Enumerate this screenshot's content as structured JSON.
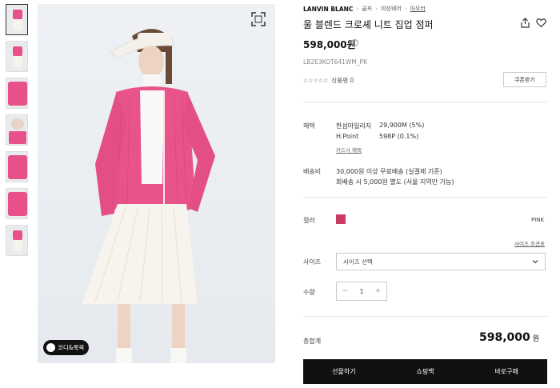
{
  "breadcrumb": {
    "brand": "LANVIN BLANC",
    "items": [
      "골프",
      "여성웨어",
      "아우터"
    ]
  },
  "product": {
    "title": "울 블렌드 크로셰 니트 집업 점퍼",
    "price": "598,000원",
    "price_info_icon": "info-icon",
    "code": "LB2E3KOT641WM_PK",
    "review_label": "상품평 0",
    "stars": "☆☆☆☆☆",
    "coupon_label": "쿠폰받기"
  },
  "image": {
    "coord_button_label": "코디&룩북"
  },
  "benefit": {
    "label": "혜택",
    "rows": [
      {
        "name": "한섬마일리지",
        "value": "29,900M (5%)"
      },
      {
        "name": "H.Point",
        "value": "598P (0.1%)"
      }
    ],
    "card_link": "카드사 혜택"
  },
  "shipping": {
    "label": "배송비",
    "line1": "30,000원 이상 무료배송 (실결제 기준)",
    "line2": "회배송 시 5,000원 별도 (서울 지역만 가능)"
  },
  "color": {
    "label": "컬러",
    "swatch": "#c93d63",
    "name": "PINK"
  },
  "size": {
    "guide_link": "사이즈 조견표",
    "label": "사이즈",
    "placeholder": "사이즈 선택"
  },
  "quantity": {
    "label": "수량",
    "minus": "−",
    "value": "1",
    "plus": "+"
  },
  "total": {
    "label": "총합계",
    "value": "598,000",
    "unit": "원"
  },
  "actions": {
    "gift": "선물하기",
    "cart": "쇼핑백",
    "buy": "바로구매"
  }
}
